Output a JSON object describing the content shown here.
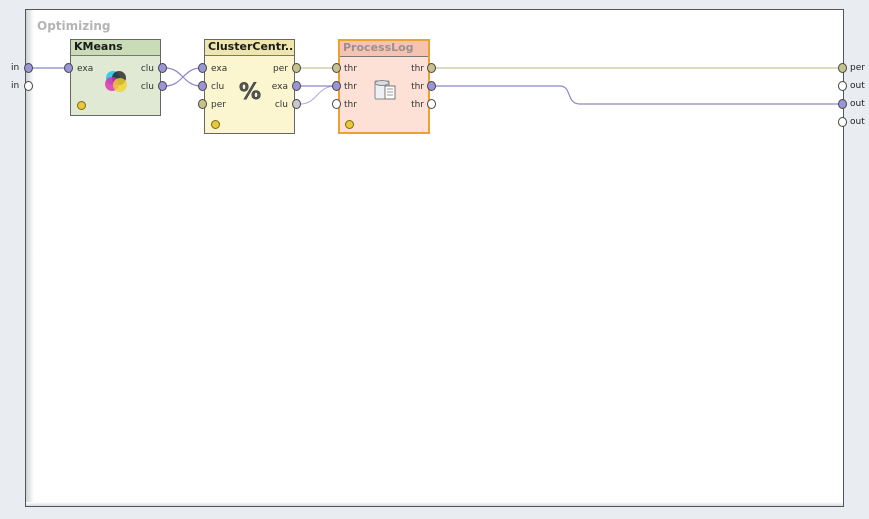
{
  "process": {
    "title": "Optimizing"
  },
  "inner_sources": [
    "in",
    "in"
  ],
  "inner_sinks": [
    "per",
    "out",
    "out",
    "out"
  ],
  "operators": {
    "kmeans": {
      "title": "KMeans",
      "inputs": [
        "exa"
      ],
      "outputs": [
        "clu",
        "clu"
      ],
      "icon": "venn-circles-icon"
    },
    "cluster_centroid": {
      "title": "ClusterCentr...",
      "inputs": [
        "exa",
        "clu",
        "per"
      ],
      "outputs": [
        "per",
        "exa",
        "clu"
      ],
      "icon": "percent-icon"
    },
    "process_log": {
      "title": "ProcessLog",
      "inputs": [
        "thr",
        "thr",
        "thr"
      ],
      "outputs": [
        "thr",
        "thr",
        "thr"
      ],
      "icon": "database-log-icon"
    }
  },
  "colors": {
    "kmeans_body": "#dfe9d4",
    "kmeans_header": "#c9dbb7",
    "centroid_body": "#fbf6cf",
    "centroid_header": "#efe6ae",
    "log_body": "#fde1d6",
    "log_header": "#f6c3b0",
    "log_border": "#f0a030",
    "wire_example": "#8c88c6",
    "wire_performance": "#c8c49a",
    "port_example": "#9a95d8",
    "port_performance": "#c9c18a",
    "port_empty": "#ffffff"
  }
}
